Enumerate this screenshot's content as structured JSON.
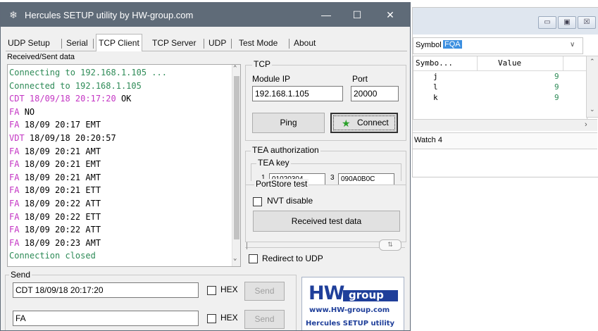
{
  "watch": {
    "btn_min": "▭",
    "btn_max": "▣",
    "btn_close": "☒",
    "symbol_label": "Symbol",
    "symbol_value": "FQA",
    "col_symbol": "Symbo...",
    "col_value": "Value",
    "rows": [
      {
        "name": "j",
        "value": "9"
      },
      {
        "name": "l",
        "value": "9"
      },
      {
        "name": "k",
        "value": "9"
      }
    ],
    "tab_label": "Watch 4"
  },
  "window": {
    "title": "Hercules SETUP utility by HW-group.com",
    "min": "—",
    "max": "☐",
    "close": "✕"
  },
  "tabs": [
    "UDP Setup",
    "Serial",
    "TCP Client",
    "TCP Server",
    "UDP",
    "Test Mode",
    "About"
  ],
  "log_label": "Received/Sent data",
  "log": [
    {
      "text": "Connecting to 192.168.1.105 ...",
      "color": "#2e8b57"
    },
    {
      "text": "Connected to 192.168.1.105",
      "color": "#2e8b57"
    },
    {
      "text": "CDT 18/09/18 20:17:20 OK",
      "color": "#c436c4",
      "split": 22
    },
    {
      "text": "FA NO",
      "color": "#c436c4",
      "split": 3
    },
    {
      "text": "FA 18/09 20:17 EMT",
      "color": "#c436c4",
      "split": 3
    },
    {
      "text": "VDT 18/09/18 20:20:57",
      "color": "#c436c4",
      "split": 4
    },
    {
      "text": "FA 18/09 20:21 AMT",
      "color": "#c436c4",
      "split": 3
    },
    {
      "text": "FA 18/09 20:21 EMT",
      "color": "#c436c4",
      "split": 3
    },
    {
      "text": "FA 18/09 20:21 AMT",
      "color": "#c436c4",
      "split": 3
    },
    {
      "text": "FA 18/09 20:21 ETT",
      "color": "#c436c4",
      "split": 3
    },
    {
      "text": "FA 18/09 20:22 ATT",
      "color": "#c436c4",
      "split": 3
    },
    {
      "text": "FA 18/09 20:22 ETT",
      "color": "#c436c4",
      "split": 3
    },
    {
      "text": "FA 18/09 20:22 ATT",
      "color": "#c436c4",
      "split": 3
    },
    {
      "text": "FA 18/09 20:23 AMT",
      "color": "#c436c4",
      "split": 3
    },
    {
      "text": "Connection closed",
      "color": "#2e8b57"
    }
  ],
  "tcp": {
    "legend": "TCP",
    "module_ip_label": "Module IP",
    "module_ip": "192.168.1.105",
    "port_label": "Port",
    "port": "20000",
    "ping_label": "Ping",
    "connect_label": "Connect"
  },
  "tea": {
    "legend": "TEA authorization",
    "key_legend": "TEA key",
    "key1_index": "1",
    "key1_partial": "01020304",
    "key3_index": "3",
    "key3_partial": "090A0B0C"
  },
  "portstore": {
    "legend": "PortStore test",
    "nvt_label": "NVT disable",
    "received_btn": "Received test data"
  },
  "redirect_label": "Redirect to UDP",
  "send": {
    "legend": "Send",
    "line1": "CDT 18/09/18 20:17:20",
    "line2": "FA",
    "hex_label": "HEX",
    "send_label": "Send"
  },
  "logo": {
    "brand_hw": "HW",
    "brand_group": "group",
    "url": "www.HW-group.com",
    "product": "Hercules SETUP utility"
  },
  "colors": {
    "titlebar": "#5f6b78",
    "log_green": "#2e8b57",
    "log_magenta": "#c436c4",
    "logo_blue": "#1f3f9a",
    "selection_blue": "#3c8fe0"
  }
}
